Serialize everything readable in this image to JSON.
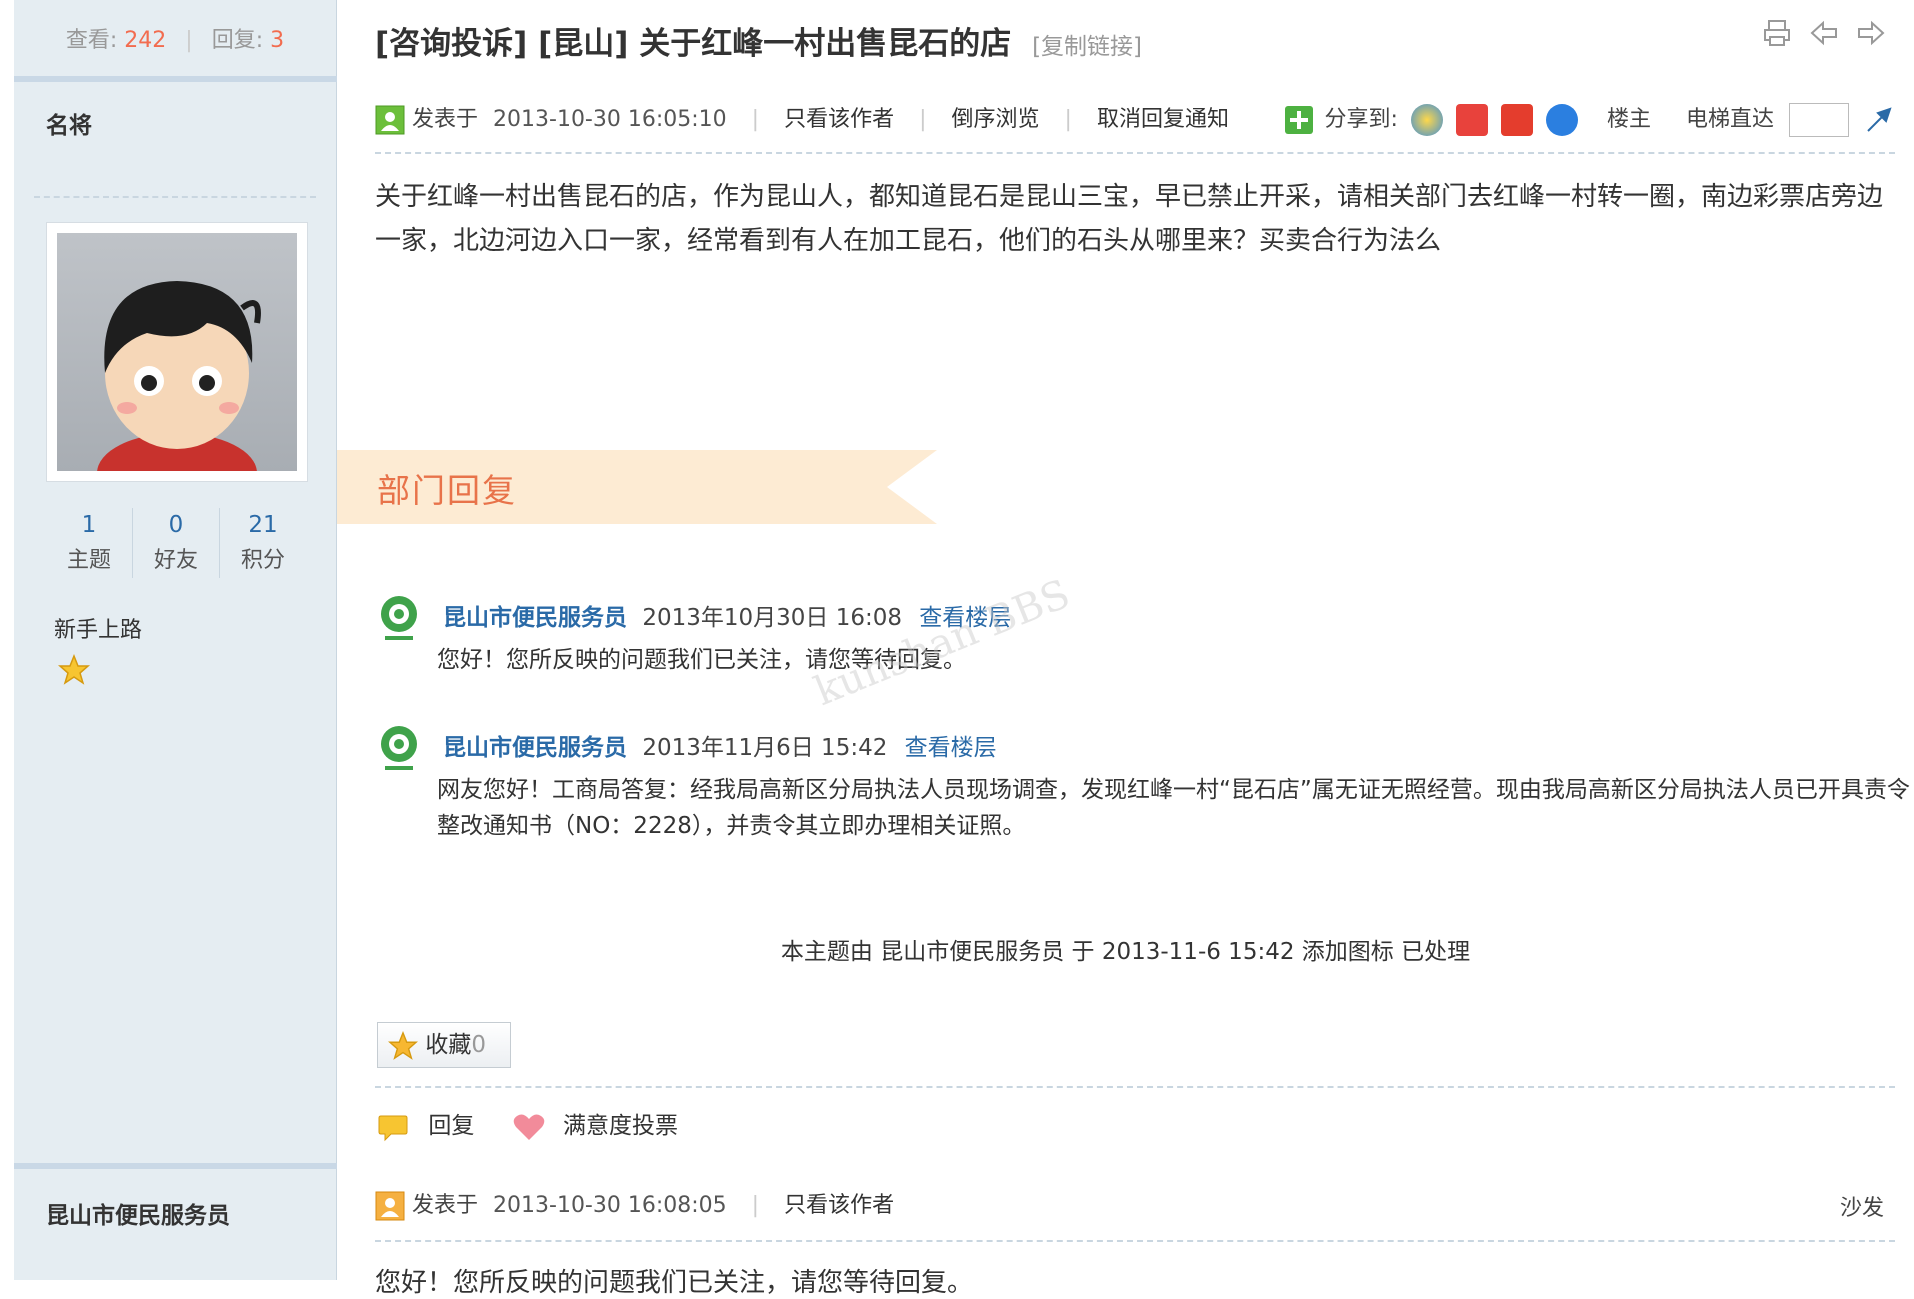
{
  "thread": {
    "views_label": "查看:",
    "views": "242",
    "replies_label": "回复:",
    "replies": "3",
    "title": "[咨询投诉] [昆山] 关于红峰一村出售昆石的店",
    "copy_link": "[复制链接]"
  },
  "post1": {
    "author": "名将",
    "stats": [
      {
        "value": "1",
        "label": "主题"
      },
      {
        "value": "0",
        "label": "好友"
      },
      {
        "value": "21",
        "label": "积分"
      }
    ],
    "rank": "新手上路",
    "posted_label": "发表于",
    "date": "2013-10-30 16:05:10",
    "only_author": "只看该作者",
    "reverse": "倒序浏览",
    "cancel_notify": "取消回复通知",
    "share_label": "分享到:",
    "floor_owner": "楼主",
    "elevator": "电梯直达",
    "content": "关于红峰一村出售昆石的店，作为昆山人，都知道昆石是昆山三宝，早已禁止开采，请相关部门去红峰一村转一圈，南边彩票店旁边一家，北边河边入口一家，经常看到有人在加工昆石，他们的石头从哪里来？买卖合行为法么",
    "dept_reply_title": "部门回复",
    "replies": [
      {
        "who": "昆山市便民服务员",
        "when": "2013年10月30日 16:08",
        "link": "查看楼层",
        "msg": "您好！您所反映的问题我们已关注，请您等待回复。"
      },
      {
        "who": "昆山市便民服务员",
        "when": "2013年11月6日 15:42",
        "link": "查看楼层",
        "msg": "网友您好！工商局答复：经我局高新区分局执法人员现场调查，发现红峰一村“昆石店”属无证无照经营。现由我局高新区分局执法人员已开具责令整改通知书（NO：2228），并责令其立即办理相关证照。"
      }
    ],
    "notice": "本主题由 昆山市便民服务员 于 2013-11-6 15:42 添加图标 已处理",
    "favorite_label": "收藏",
    "favorite_count": "0",
    "reply_action": "回复",
    "vote_action": "满意度投票"
  },
  "post2": {
    "author": "昆山市便民服务员",
    "posted_label": "发表于",
    "date": "2013-10-30 16:08:05",
    "only_author": "只看该作者",
    "floor": "沙发",
    "content_cut": "您好！您所反映的问题我们已关注，请您等待回复。"
  },
  "watermark": "kunshan BBS",
  "colors": {
    "accent_orange": "#f26c4f",
    "link_blue": "#2a6aa7",
    "sidebar_bg": "#e5edf2",
    "dept_bg": "#fdebd3"
  }
}
